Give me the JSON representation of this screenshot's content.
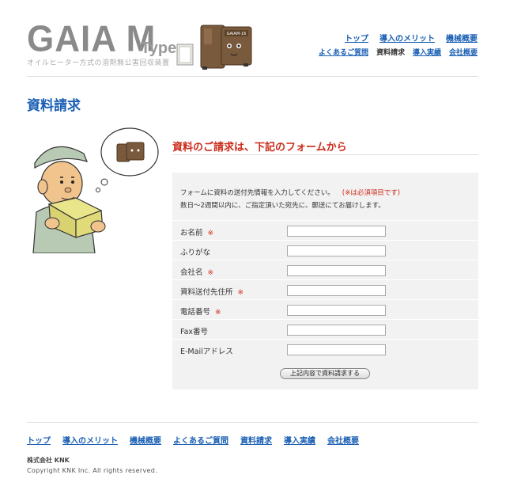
{
  "header": {
    "logo_main": "GAIA M",
    "logo_type": "Type",
    "logo_sub": "オイルヒーター方式の溶剤無公害回収装置",
    "machine_label": "GAIAM-16"
  },
  "nav": {
    "row1": [
      {
        "label": "トップ",
        "current": false
      },
      {
        "label": "導入のメリット",
        "current": false
      },
      {
        "label": "機械概要",
        "current": false
      }
    ],
    "row2": [
      {
        "label": "よくあるご質問",
        "current": false
      },
      {
        "label": "資料請求",
        "current": true
      },
      {
        "label": "導入実績",
        "current": false
      },
      {
        "label": "会社概要",
        "current": false
      }
    ]
  },
  "page": {
    "title": "資料請求",
    "section_heading": "資料のご請求は、下記のフォームから"
  },
  "form": {
    "intro_line1": "フォームに資料の送付先情報を入力してください。",
    "required_note": "(※は必須項目です)",
    "intro_line2": "数日〜2週間以内に、ご指定頂いた宛先に、郵送にてお届けします。",
    "required_mark": "※",
    "fields": [
      {
        "label": "お名前",
        "required": true,
        "value": ""
      },
      {
        "label": "ふりがな",
        "required": false,
        "value": ""
      },
      {
        "label": "会社名",
        "required": true,
        "value": ""
      },
      {
        "label": "資料送付先住所",
        "required": true,
        "value": ""
      },
      {
        "label": "電話番号",
        "required": true,
        "value": ""
      },
      {
        "label": "Fax番号",
        "required": false,
        "value": ""
      },
      {
        "label": "E-Mailアドレス",
        "required": false,
        "value": ""
      }
    ],
    "submit_label": "上記内容で資料請求する"
  },
  "footer": {
    "links": [
      "トップ",
      "導入のメリット",
      "機械概要",
      "よくあるご質問",
      "資料請求",
      "導入実績",
      "会社概要"
    ],
    "company": "株式会社 KNK",
    "copyright": "Copyright KNK Inc. All rights reserved."
  },
  "colors": {
    "link": "#1a5fb4",
    "accent_red": "#cc2a1a",
    "form_bg": "#f2f2f2"
  }
}
